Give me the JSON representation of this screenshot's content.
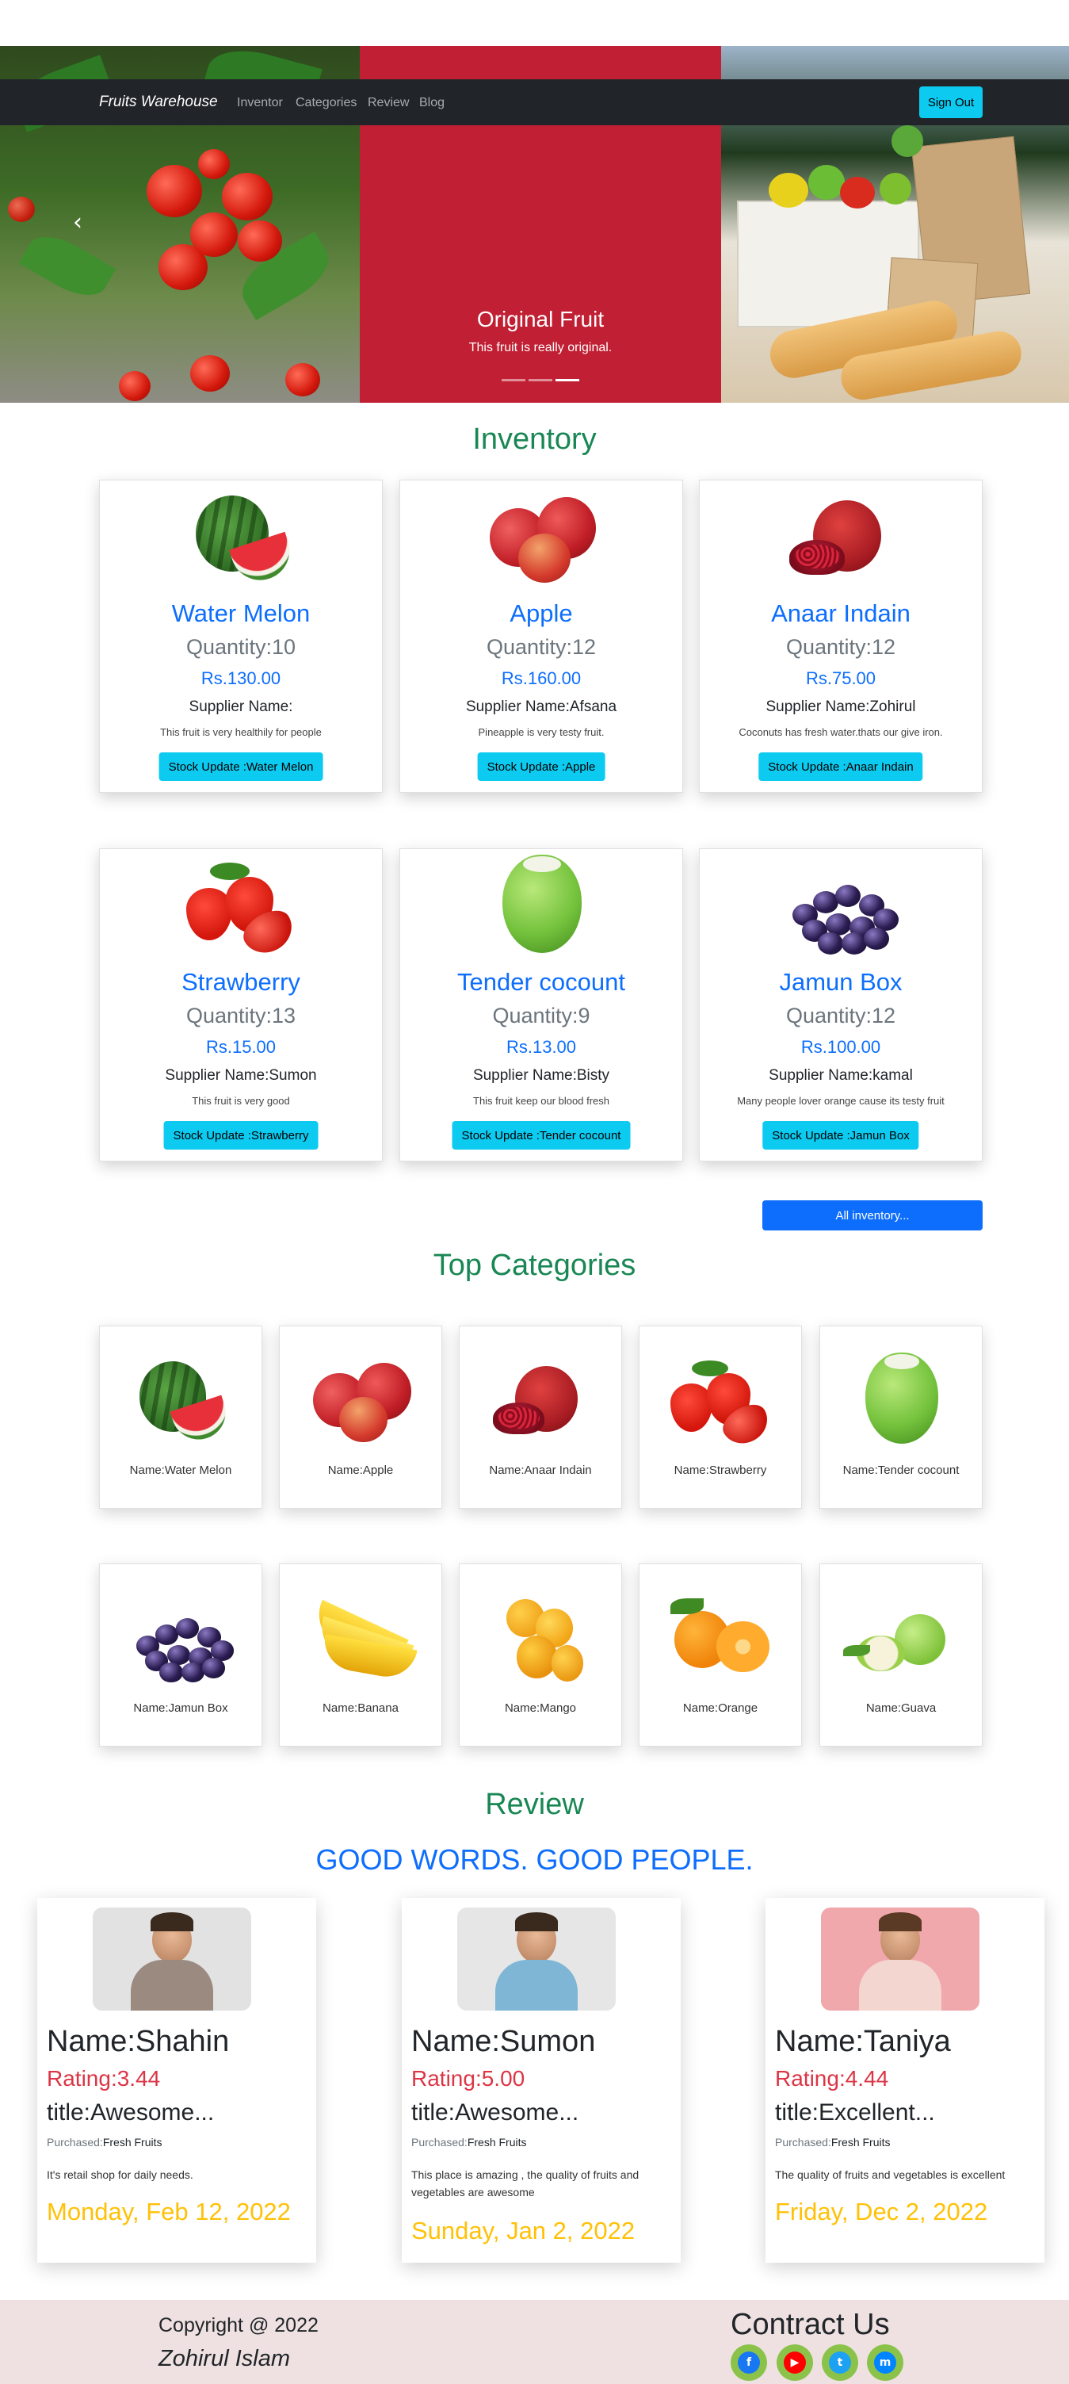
{
  "nav": {
    "brand": "Fruits Warehouse",
    "links": [
      "Inventor",
      "Categories",
      "Review",
      "Blog"
    ],
    "sign_out": "Sign Out"
  },
  "hero": {
    "title": "Original Fruit",
    "text": "This fruit is really original.",
    "prev_icon": "‹",
    "active_slide": 3,
    "slide_count": 3
  },
  "inventory": {
    "title": "Inventory",
    "items": [
      {
        "name": "Water Melon",
        "quantity": "Quantity:10",
        "price": "Rs.130.00",
        "supplier": "Supplier Name:",
        "description": "This fruit is very healthily for people",
        "button": "Stock Update :Water Melon",
        "icon": "watermelon-icon"
      },
      {
        "name": "Apple",
        "quantity": "Quantity:12",
        "price": "Rs.160.00",
        "supplier": "Supplier Name:Afsana",
        "description": "Pineapple is very testy fruit.",
        "button": "Stock Update :Apple",
        "icon": "apple-icon"
      },
      {
        "name": "Anaar Indain",
        "quantity": "Quantity:12",
        "price": "Rs.75.00",
        "supplier": "Supplier Name:Zohirul",
        "description": "Coconuts has fresh water.thats our give iron.",
        "button": "Stock Update :Anaar Indain",
        "icon": "pomegranate-icon"
      },
      {
        "name": "Strawberry",
        "quantity": "Quantity:13",
        "price": "Rs.15.00",
        "supplier": "Supplier Name:Sumon",
        "description": "This fruit is very good",
        "button": "Stock Update :Strawberry",
        "icon": "strawberry-icon"
      },
      {
        "name": "Tender cocount",
        "quantity": "Quantity:9",
        "price": "Rs.13.00",
        "supplier": "Supplier Name:Bisty",
        "description": "This fruit keep our blood fresh",
        "button": "Stock Update :Tender cocount",
        "icon": "coconut-icon"
      },
      {
        "name": "Jamun Box",
        "quantity": "Quantity:12",
        "price": "Rs.100.00",
        "supplier": "Supplier Name:kamal",
        "description": "Many people lover orange cause its testy fruit",
        "button": "Stock Update :Jamun Box",
        "icon": "jamun-icon"
      }
    ],
    "all_button": "All inventory..."
  },
  "categories": {
    "title": "Top Categories",
    "items": [
      {
        "name": "Name:Water Melon",
        "icon": "watermelon-icon"
      },
      {
        "name": "Name:Apple",
        "icon": "apple-icon"
      },
      {
        "name": "Name:Anaar Indain",
        "icon": "pomegranate-icon"
      },
      {
        "name": "Name:Strawberry",
        "icon": "strawberry-icon"
      },
      {
        "name": "Name:Tender cocount",
        "icon": "coconut-icon"
      },
      {
        "name": "Name:Jamun Box",
        "icon": "jamun-icon"
      },
      {
        "name": "Name:Banana",
        "icon": "banana-icon"
      },
      {
        "name": "Name:Mango",
        "icon": "mango-icon"
      },
      {
        "name": "Name:Orange",
        "icon": "orange-icon"
      },
      {
        "name": "Name:Guava",
        "icon": "guava-icon"
      }
    ]
  },
  "review": {
    "title": "Review",
    "subtitle": "GOOD WORDS. GOOD PEOPLE.",
    "items": [
      {
        "name": "Name:Shahin",
        "rating": "Rating:3.44",
        "title": "title:Awesome...",
        "purchased_label": "Purchased:",
        "purchased": "Fresh Fruits",
        "body": "It's retail shop for daily needs.",
        "date": "Monday, Feb 12, 2022",
        "photo_bg": "#e2e2e2"
      },
      {
        "name": "Name:Sumon",
        "rating": "Rating:5.00",
        "title": "title:Awesome...",
        "purchased_label": "Purchased:",
        "purchased": "Fresh Fruits",
        "body": "This place is amazing , the quality of fruits and vegetables are awesome",
        "date": "Sunday, Jan 2, 2022",
        "photo_bg": "#e6e6e6"
      },
      {
        "name": "Name:Taniya",
        "rating": "Rating:4.44",
        "title": "title:Excellent...",
        "purchased_label": "Purchased:",
        "purchased": "Fresh Fruits",
        "body": "The quality of fruits and vegetables is excellent",
        "date": "Friday, Dec 2, 2022",
        "photo_bg": "#f0a8ac"
      }
    ]
  },
  "footer": {
    "copyright": "Copyright @ 2022",
    "author": "Zohirul Islam",
    "contact_title": "Contract Us",
    "social": [
      {
        "icon": "facebook-icon",
        "glyph": "f",
        "color": "#1877f2"
      },
      {
        "icon": "youtube-icon",
        "glyph": "▶",
        "color": "#ff0000"
      },
      {
        "icon": "twitter-icon",
        "glyph": "t",
        "color": "#1da1f2"
      },
      {
        "icon": "messenger-icon",
        "glyph": "m",
        "color": "#0084ff"
      }
    ]
  },
  "colors": {
    "navbar": "#212529",
    "hero_mid": "#c11f33",
    "section_title": "#198754",
    "primary": "#0d6efd",
    "info": "#0dcaf0",
    "rating": "#dc3545",
    "date": "#ffc107",
    "footer": "#efe1e1"
  }
}
